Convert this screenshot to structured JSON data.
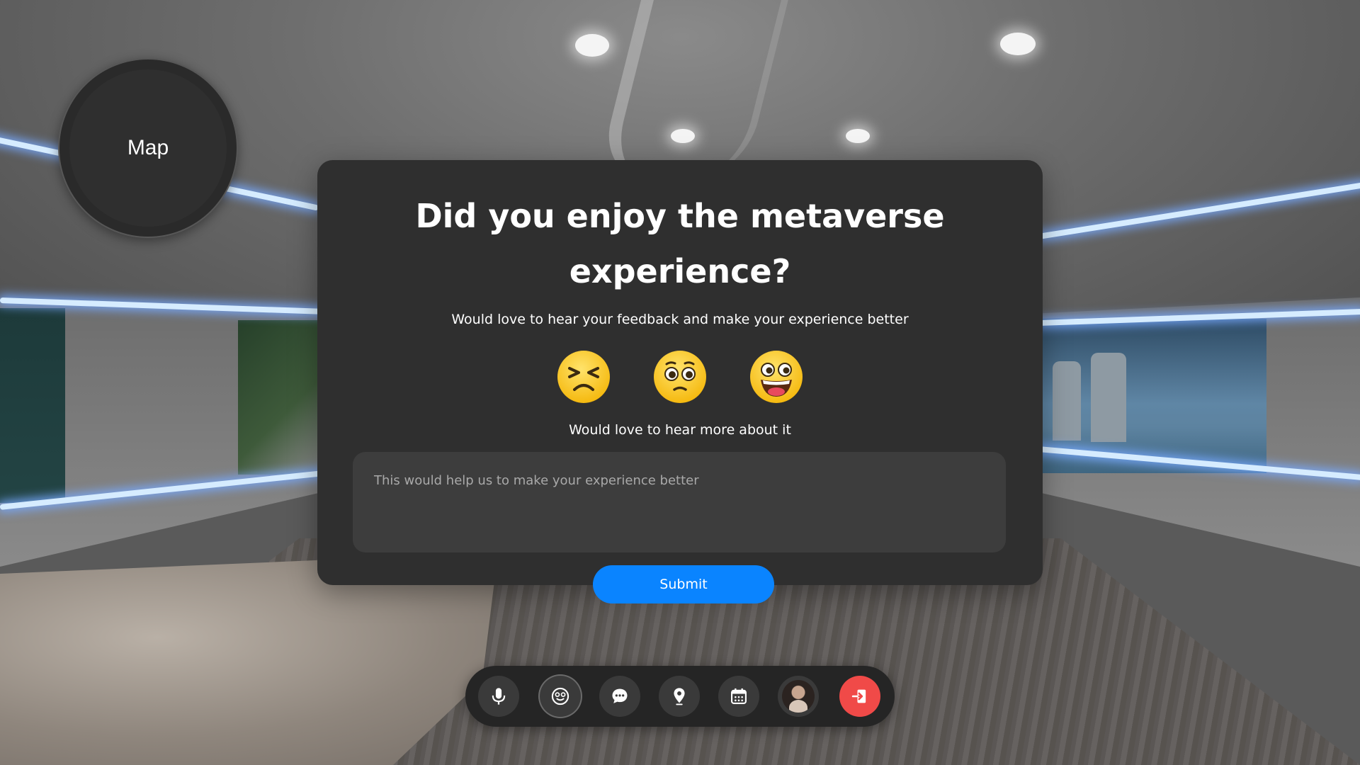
{
  "map": {
    "label": "Map"
  },
  "feedback": {
    "title_line1": "Did you enjoy the metaverse",
    "title_line2": "experience?",
    "subtitle": "Would love to hear your feedback and make your experience better",
    "ratings": [
      {
        "icon": "tired-face-icon"
      },
      {
        "icon": "pleading-face-icon"
      },
      {
        "icon": "grinning-face-icon"
      }
    ],
    "more_prompt": "Would love to hear more about it",
    "textarea_placeholder": "This would help us to make your experience better",
    "submit_label": "Submit"
  },
  "toolbar": {
    "buttons": [
      {
        "icon": "microphone-icon"
      },
      {
        "icon": "emoji-reactions-icon"
      },
      {
        "icon": "chat-bubble-icon"
      },
      {
        "icon": "location-pin-icon"
      },
      {
        "icon": "calendar-icon"
      },
      {
        "icon": "avatar-icon"
      },
      {
        "icon": "leave-icon"
      }
    ],
    "leave_color": "#f04a48"
  },
  "colors": {
    "modal_bg": "#2f2f2f",
    "accent": "#0a84ff"
  }
}
